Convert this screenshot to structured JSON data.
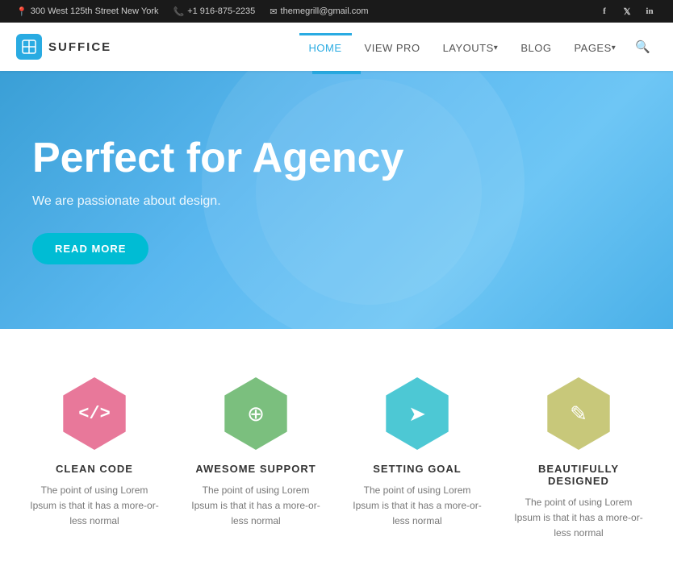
{
  "topbar": {
    "address": "300 West 125th Street New York",
    "phone": "+1 916-875-2235",
    "email": "themegrill@gmail.com",
    "social": [
      {
        "name": "facebook",
        "symbol": "f"
      },
      {
        "name": "twitter",
        "symbol": "t"
      },
      {
        "name": "linkedin",
        "symbol": "in"
      }
    ]
  },
  "header": {
    "logo_text": "SUFFICE",
    "nav_items": [
      {
        "label": "HOME",
        "active": true
      },
      {
        "label": "VIEW PRO",
        "active": false
      },
      {
        "label": "LAYOUTS",
        "active": false,
        "dropdown": true
      },
      {
        "label": "BLOG",
        "active": false
      },
      {
        "label": "PAGES",
        "active": false,
        "dropdown": true
      }
    ]
  },
  "hero": {
    "title": "Perfect for Agency",
    "subtitle": "We are passionate about design.",
    "cta_label": "READ MORE"
  },
  "features": [
    {
      "icon": "</> ",
      "color": "hex-pink",
      "title": "CLEAN CODE",
      "desc": "The point of using Lorem Ipsum is that it has a more-or-less normal"
    },
    {
      "icon": "⊕",
      "color": "hex-green",
      "title": "AWESOME SUPPORT",
      "desc": "The point of using Lorem Ipsum is that it has a more-or-less normal"
    },
    {
      "icon": "➤",
      "color": "hex-cyan",
      "title": "SETTING GOAL",
      "desc": "The point of using Lorem Ipsum is that it has a more-or-less normal"
    },
    {
      "icon": "✎",
      "color": "hex-yellow",
      "title": "BEAUTIFULLY DESIGNED",
      "desc": "The point of using Lorem Ipsum is that it has a more-or-less normal"
    }
  ]
}
